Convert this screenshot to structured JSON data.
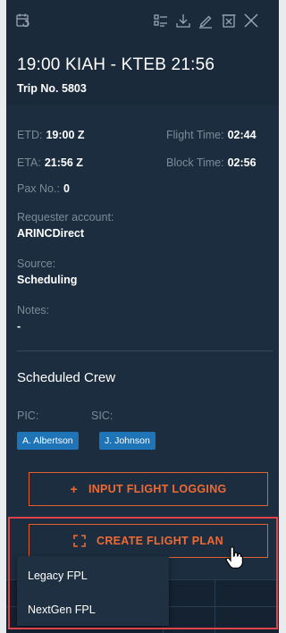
{
  "trip": {
    "route": "19:00 KIAH - KTEB 21:56",
    "trip_no": "Trip No. 5803"
  },
  "details": {
    "etd_label": "ETD:",
    "etd_value": "19:00 Z",
    "eta_label": "ETA:",
    "eta_value": "21:56 Z",
    "flight_time_label": "Flight Time:",
    "flight_time_value": "02:44",
    "block_time_label": "Block Time:",
    "block_time_value": "02:56",
    "pax_label": "Pax No.:",
    "pax_value": "0",
    "requester_label": "Requester account:",
    "requester_value": "ARINCDirect",
    "source_label": "Source:",
    "source_value": "Scheduling",
    "notes_label": "Notes:",
    "notes_value": "-"
  },
  "crew": {
    "title": "Scheduled Crew",
    "pic_label": "PIC:",
    "sic_label": "SIC:",
    "pic_name": "A. Albertson",
    "sic_name": "J. Johnson"
  },
  "actions": {
    "input_logging_plus": "+",
    "input_logging": "INPUT FLIGHT LOGGING",
    "create_plan": "CREATE FLIGHT PLAN"
  },
  "menu": {
    "items": [
      "Legacy FPL",
      "NextGen FPL"
    ]
  },
  "icons": {
    "toolbar": [
      "calendar-sync-icon",
      "list-settings-icon",
      "download-icon",
      "edit-icon",
      "delete-icon",
      "close-icon"
    ]
  },
  "colors": {
    "panel": "#1c2d3f",
    "accent": "#f06a33",
    "chip": "#1f73b7",
    "highlight": "#e0434a"
  }
}
